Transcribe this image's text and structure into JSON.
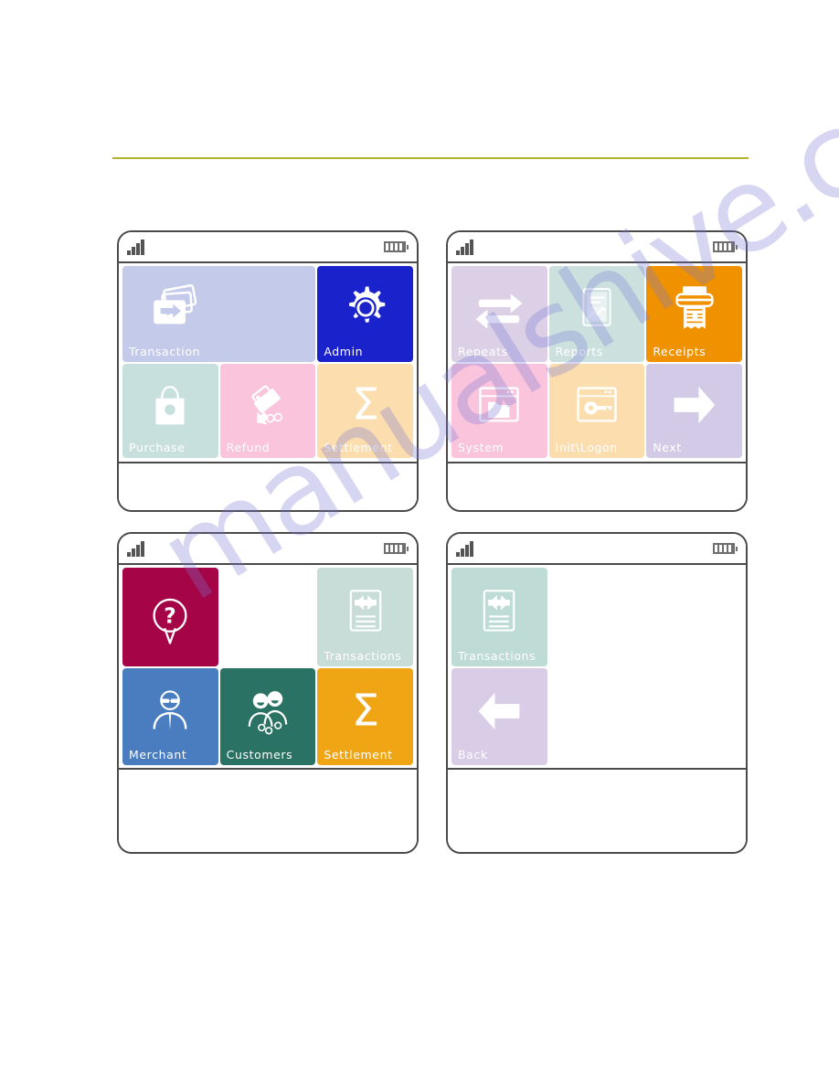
{
  "page": {
    "background_color": "#ffffff",
    "header_rule_color": "#b5b32b",
    "watermark_text": "manualshive.com"
  },
  "status_bar": {
    "signal_icon": "signal-bars-icon",
    "signal_bars": 4,
    "battery_icon": "battery-icon",
    "battery_bars": 4
  },
  "devices": [
    {
      "id": "device-1",
      "name": "main-menu-screen",
      "tiles": [
        {
          "label": "Transaction",
          "icon": "card-transaction-icon",
          "bg": "#c3caea",
          "text_color": "#ffffff",
          "span": 2
        },
        {
          "label": "Admin",
          "icon": "gear-icon",
          "bg": "#1a22cc",
          "text_color": "#ffffff",
          "span": 1
        },
        {
          "label": "Purchase",
          "icon": "shopping-bag-icon",
          "bg": "#c8e0dd",
          "text_color": "#ffffff",
          "span": 1
        },
        {
          "label": "Refund",
          "icon": "refund-money-icon",
          "bg": "#f9c4dc",
          "text_color": "#ffffff",
          "span": 1
        },
        {
          "label": "Settlement",
          "icon": "sigma-icon",
          "bg": "#fbddae",
          "text_color": "#ffffff",
          "span": 1
        }
      ]
    },
    {
      "id": "device-2",
      "name": "admin-menu-screen",
      "tiles": [
        {
          "label": "Repeats",
          "icon": "repeat-arrows-icon",
          "bg": "#dcd0e6",
          "text_color": "#ffffff",
          "span": 1
        },
        {
          "label": "Reports",
          "icon": "report-chart-icon",
          "bg": "#cce1de",
          "text_color": "#ffffff",
          "span": 1
        },
        {
          "label": "Receipts",
          "icon": "printer-receipt-icon",
          "bg": "#f09200",
          "text_color": "#ffffff",
          "span": 1
        },
        {
          "label": "System",
          "icon": "window-folder-icon",
          "bg": "#f9c4dc",
          "text_color": "#ffffff",
          "span": 1
        },
        {
          "label": "Init\\Logon",
          "icon": "window-key-icon",
          "bg": "#fbddae",
          "text_color": "#ffffff",
          "span": 1
        },
        {
          "label": "Next",
          "icon": "arrow-right-icon",
          "bg": "#d2cae6",
          "text_color": "#ffffff",
          "span": 1
        }
      ]
    },
    {
      "id": "device-3",
      "name": "reports-menu-screen",
      "tiles": [
        {
          "label": "",
          "icon": "question-bubble-icon",
          "bg": "#a50546",
          "text_color": "#ffffff",
          "span": 1
        },
        {
          "label": "",
          "icon": "",
          "bg": "transparent",
          "text_color": "#ffffff",
          "span": 1,
          "empty": true
        },
        {
          "label": "Transactions",
          "icon": "document-transfer-icon",
          "bg": "#c8ddd8",
          "text_color": "#ffffff",
          "span": 1
        },
        {
          "label": "Merchant",
          "icon": "merchant-person-icon",
          "bg": "#4a7dc0",
          "text_color": "#ffffff",
          "span": 1
        },
        {
          "label": "Customers",
          "icon": "customers-people-icon",
          "bg": "#2a7264",
          "text_color": "#ffffff",
          "span": 1
        },
        {
          "label": "Settlement",
          "icon": "sigma-icon",
          "bg": "#f0a515",
          "text_color": "#ffffff",
          "span": 1
        }
      ]
    },
    {
      "id": "device-4",
      "name": "transactions-submenu-screen",
      "tiles": [
        {
          "label": "Transactions",
          "icon": "document-transfer-icon",
          "bg": "#bedcd5",
          "text_color": "#ffffff",
          "span": 1
        },
        {
          "label": "",
          "icon": "",
          "bg": "transparent",
          "text_color": "#ffffff",
          "span": 1,
          "empty": true
        },
        {
          "label": "",
          "icon": "",
          "bg": "transparent",
          "text_color": "#ffffff",
          "span": 1,
          "empty": true
        },
        {
          "label": "Back",
          "icon": "arrow-left-icon",
          "bg": "#d8cce6",
          "text_color": "#ffffff",
          "span": 1
        },
        {
          "label": "",
          "icon": "",
          "bg": "transparent",
          "text_color": "#ffffff",
          "span": 1,
          "empty": true
        },
        {
          "label": "",
          "icon": "",
          "bg": "transparent",
          "text_color": "#ffffff",
          "span": 1,
          "empty": true
        }
      ]
    }
  ]
}
